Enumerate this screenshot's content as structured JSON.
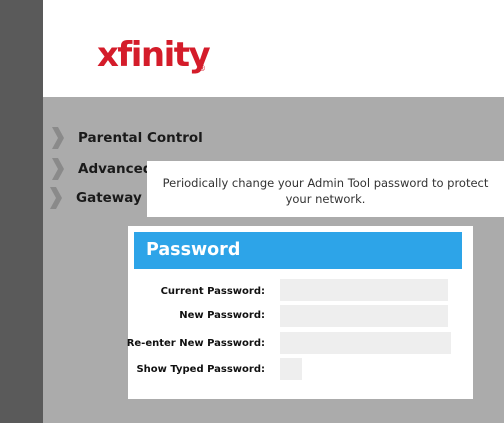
{
  "brand": {
    "logo_text": "xfinity",
    "registered_mark": "®"
  },
  "nav": {
    "items": [
      {
        "label": "Parental Control",
        "icon": "chevron-right-icon"
      },
      {
        "label": "Advanced",
        "icon": "chevron-right-icon"
      },
      {
        "label": "Gateway",
        "icon": "chevron-right-icon"
      }
    ]
  },
  "tooltip": {
    "text": "Periodically change your Admin Tool password to protect your network."
  },
  "password_panel": {
    "title": "Password",
    "fields": [
      {
        "label": "Current Password:",
        "value": "",
        "placeholder": ""
      },
      {
        "label": "New Password:",
        "value": "",
        "placeholder": ""
      },
      {
        "label": "Re-enter New Password:",
        "value": "",
        "placeholder": ""
      }
    ],
    "show_typed": {
      "label": "Show Typed Password:",
      "checked": false
    }
  },
  "colors": {
    "brand_red": "#d41c2a",
    "panel_header_blue": "#2da4e8",
    "background_gray": "#ababab",
    "sidebar_dark": "#5a5a5a"
  }
}
